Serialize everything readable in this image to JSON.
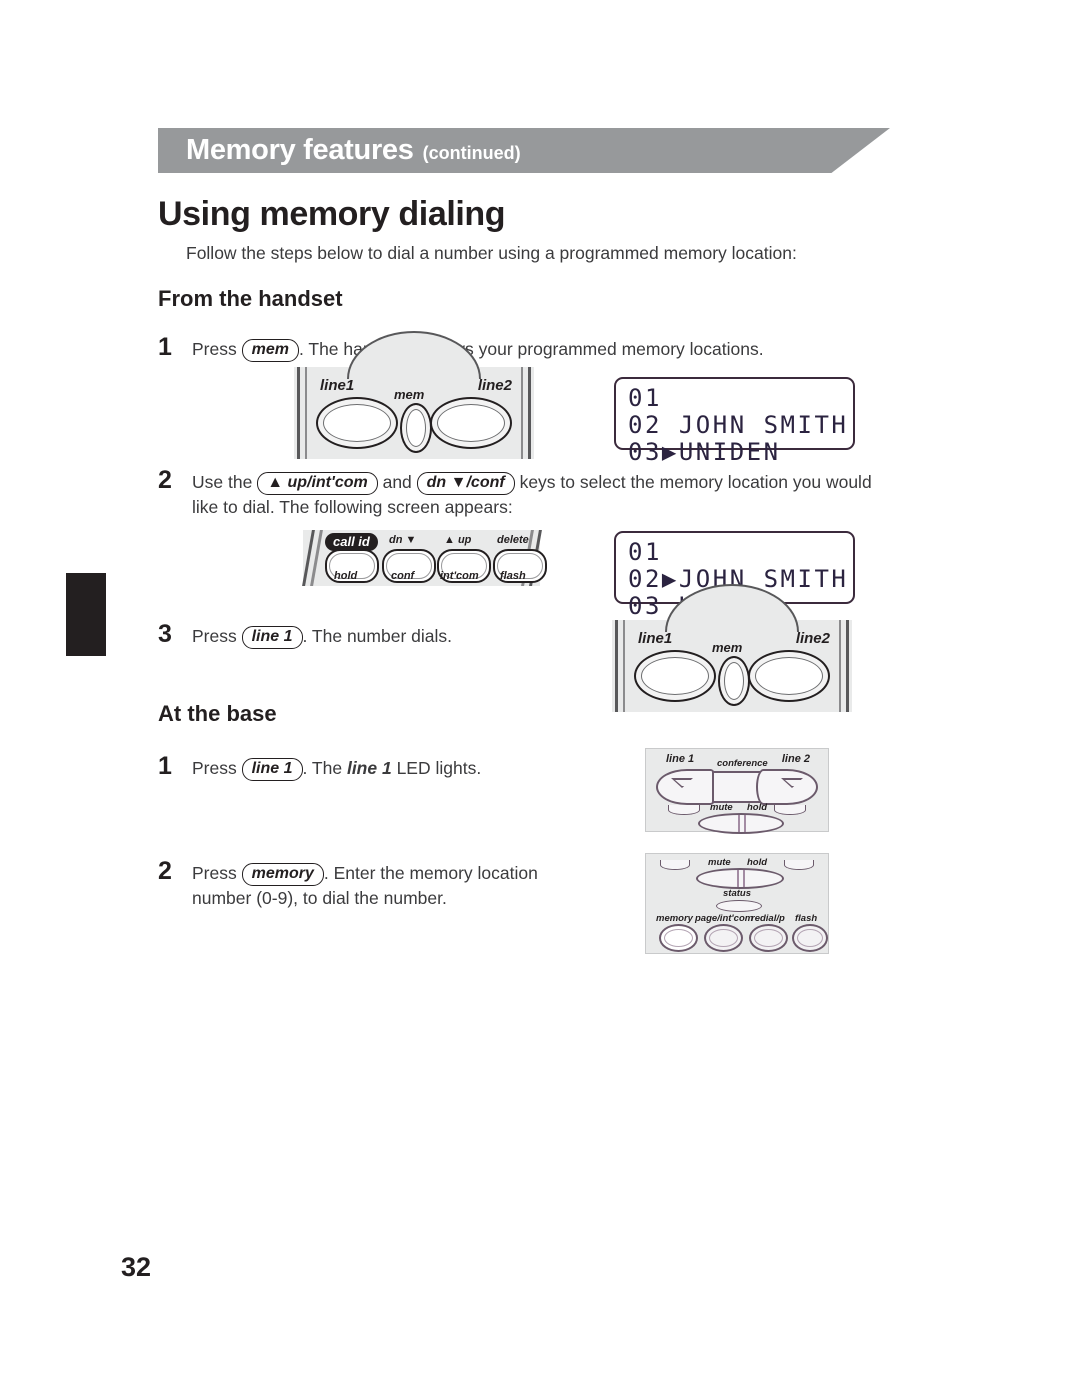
{
  "header": {
    "title": "Memory features",
    "continued": "(continued)",
    "banner_color": "#97999b"
  },
  "page": {
    "heading": "Using memory dialing",
    "intro": "Follow the steps below to dial a number using a programmed memory location:",
    "number": "32"
  },
  "sections": [
    {
      "title": "From the handset"
    },
    {
      "title": "At the base"
    }
  ],
  "handset_steps": [
    {
      "num": "1",
      "pre": "Press ",
      "key": "mem",
      "post": ". The handset displays your programmed memory locations."
    },
    {
      "num": "2",
      "pre": "Use the ",
      "key_up": "▲ up/int'com",
      "mid": " and ",
      "key_dn": "dn ▼/conf",
      "post": " keys to select the memory location you would like to dial. The following screen appears:"
    },
    {
      "num": "3",
      "pre": "Press ",
      "key": "line 1",
      "post": ". The number dials."
    }
  ],
  "base_steps": [
    {
      "num": "1",
      "pre": "Press ",
      "key": "line 1",
      "mid": ". The ",
      "emph": "line 1",
      "post": " LED lights."
    },
    {
      "num": "2",
      "pre": "Press ",
      "key": "memory",
      "post": ". Enter the memory location number (0-9), to dial the number."
    }
  ],
  "lcd_screens": [
    {
      "name": "memory-list-uniden-selected",
      "lines": [
        "01",
        "02 JOHN SMITH",
        "03▶UNIDEN"
      ]
    },
    {
      "name": "memory-list-john-smith-selected",
      "lines": [
        "01",
        "02▶JOHN SMITH",
        "03 UNIDEN"
      ]
    }
  ],
  "handset_illustration": {
    "line1": "line1",
    "mem": "mem",
    "line2": "line2"
  },
  "keypad_illustration": {
    "top": [
      "call id",
      "dn ▼",
      "▲ up",
      "delete"
    ],
    "bottom": [
      "hold",
      "conf",
      "int'com",
      "flash"
    ]
  },
  "base_illustration_top": {
    "line1": "line 1",
    "conference": "conference",
    "line2": "line 2",
    "mute": "mute",
    "hold": "hold"
  },
  "base_illustration_bottom": {
    "mute": "mute",
    "hold": "hold",
    "status": "status",
    "buttons": [
      "memory",
      "page/int'com",
      "redial/p",
      "flash"
    ]
  }
}
